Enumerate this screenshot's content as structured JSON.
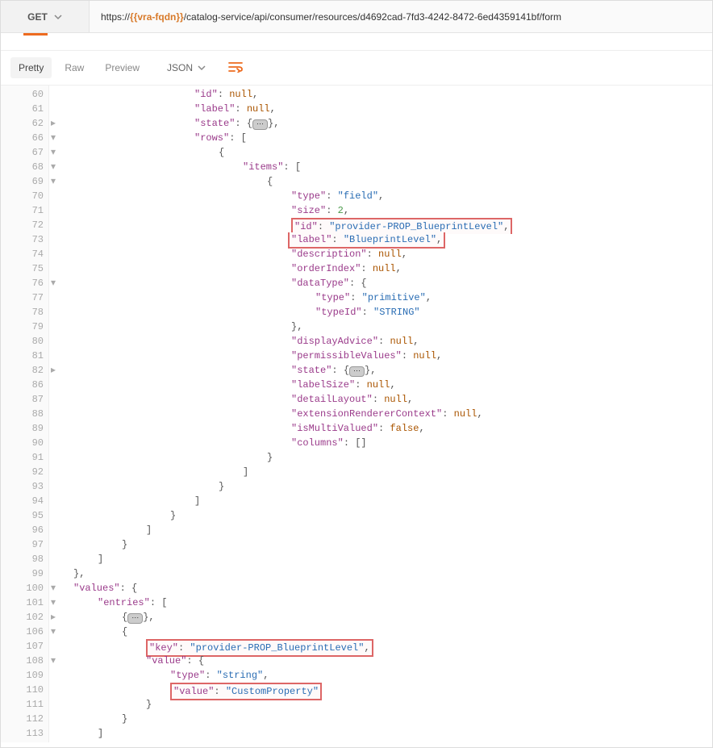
{
  "request": {
    "method": "GET",
    "url_prefix": "https://",
    "url_var": "{{vra-fqdn}}",
    "url_suffix": "/catalog-service/api/consumer/resources/d4692cad-7fd3-4242-8472-6ed4359141bf/form"
  },
  "tabs": {
    "pretty": "Pretty",
    "raw": "Raw",
    "preview": "Preview",
    "format": "JSON"
  },
  "lines": [
    {
      "no": "60",
      "m": "",
      "ind": 240,
      "t": [
        [
          "k",
          "\"id\""
        ],
        [
          "p",
          ": "
        ],
        [
          "kw",
          "null"
        ],
        [
          "p",
          ","
        ]
      ]
    },
    {
      "no": "61",
      "m": "",
      "ind": 240,
      "t": [
        [
          "k",
          "\"label\""
        ],
        [
          "p",
          ": "
        ],
        [
          "kw",
          "null"
        ],
        [
          "p",
          ","
        ]
      ]
    },
    {
      "no": "62",
      "m": "▸",
      "ind": 240,
      "t": [
        [
          "k",
          "\"state\""
        ],
        [
          "p",
          ": {"
        ],
        [
          "collap",
          "⋯"
        ],
        [
          "p",
          "},"
        ]
      ]
    },
    {
      "no": "66",
      "m": "▾",
      "ind": 240,
      "t": [
        [
          "k",
          "\"rows\""
        ],
        [
          "p",
          ": ["
        ]
      ]
    },
    {
      "no": "67",
      "m": "▾",
      "ind": 270,
      "t": [
        [
          "p",
          "{"
        ]
      ]
    },
    {
      "no": "68",
      "m": "▾",
      "ind": 300,
      "t": [
        [
          "k",
          "\"items\""
        ],
        [
          "p",
          ": ["
        ]
      ]
    },
    {
      "no": "69",
      "m": "▾",
      "ind": 330,
      "t": [
        [
          "p",
          "{"
        ]
      ]
    },
    {
      "no": "70",
      "m": "",
      "ind": 360,
      "t": [
        [
          "k",
          "\"type\""
        ],
        [
          "p",
          ": "
        ],
        [
          "s",
          "\"field\""
        ],
        [
          "p",
          ","
        ]
      ]
    },
    {
      "no": "71",
      "m": "",
      "ind": 360,
      "t": [
        [
          "k",
          "\"size\""
        ],
        [
          "p",
          ": "
        ],
        [
          "n",
          "2"
        ],
        [
          "p",
          ","
        ]
      ]
    },
    {
      "no": "72",
      "m": "",
      "ind": 360,
      "hl": true,
      "t": [
        [
          "k",
          "\"id\""
        ],
        [
          "p",
          ": "
        ],
        [
          "s",
          "\"provider-PROP_BlueprintLevel\""
        ],
        [
          "p",
          ","
        ]
      ]
    },
    {
      "no": "73",
      "m": "",
      "ind": 360,
      "hl": true,
      "samebox": true,
      "t": [
        [
          "k",
          "\"label\""
        ],
        [
          "p",
          ": "
        ],
        [
          "s",
          "\"BlueprintLevel\""
        ],
        [
          "p",
          ","
        ]
      ]
    },
    {
      "no": "74",
      "m": "",
      "ind": 360,
      "t": [
        [
          "k",
          "\"description\""
        ],
        [
          "p",
          ": "
        ],
        [
          "kw",
          "null"
        ],
        [
          "p",
          ","
        ]
      ]
    },
    {
      "no": "75",
      "m": "",
      "ind": 360,
      "t": [
        [
          "k",
          "\"orderIndex\""
        ],
        [
          "p",
          ": "
        ],
        [
          "kw",
          "null"
        ],
        [
          "p",
          ","
        ]
      ]
    },
    {
      "no": "76",
      "m": "▾",
      "ind": 360,
      "t": [
        [
          "k",
          "\"dataType\""
        ],
        [
          "p",
          ": {"
        ]
      ]
    },
    {
      "no": "77",
      "m": "",
      "ind": 390,
      "t": [
        [
          "k",
          "\"type\""
        ],
        [
          "p",
          ": "
        ],
        [
          "s",
          "\"primitive\""
        ],
        [
          "p",
          ","
        ]
      ]
    },
    {
      "no": "78",
      "m": "",
      "ind": 390,
      "t": [
        [
          "k",
          "\"typeId\""
        ],
        [
          "p",
          ": "
        ],
        [
          "s",
          "\"STRING\""
        ]
      ]
    },
    {
      "no": "79",
      "m": "",
      "ind": 360,
      "t": [
        [
          "p",
          "},"
        ]
      ]
    },
    {
      "no": "80",
      "m": "",
      "ind": 360,
      "t": [
        [
          "k",
          "\"displayAdvice\""
        ],
        [
          "p",
          ": "
        ],
        [
          "kw",
          "null"
        ],
        [
          "p",
          ","
        ]
      ]
    },
    {
      "no": "81",
      "m": "",
      "ind": 360,
      "t": [
        [
          "k",
          "\"permissibleValues\""
        ],
        [
          "p",
          ": "
        ],
        [
          "kw",
          "null"
        ],
        [
          "p",
          ","
        ]
      ]
    },
    {
      "no": "82",
      "m": "▸",
      "ind": 360,
      "t": [
        [
          "k",
          "\"state\""
        ],
        [
          "p",
          ": {"
        ],
        [
          "collap",
          "⋯"
        ],
        [
          "p",
          "},"
        ]
      ]
    },
    {
      "no": "86",
      "m": "",
      "ind": 360,
      "t": [
        [
          "k",
          "\"labelSize\""
        ],
        [
          "p",
          ": "
        ],
        [
          "kw",
          "null"
        ],
        [
          "p",
          ","
        ]
      ]
    },
    {
      "no": "87",
      "m": "",
      "ind": 360,
      "t": [
        [
          "k",
          "\"detailLayout\""
        ],
        [
          "p",
          ": "
        ],
        [
          "kw",
          "null"
        ],
        [
          "p",
          ","
        ]
      ]
    },
    {
      "no": "88",
      "m": "",
      "ind": 360,
      "t": [
        [
          "k",
          "\"extensionRendererContext\""
        ],
        [
          "p",
          ": "
        ],
        [
          "kw",
          "null"
        ],
        [
          "p",
          ","
        ]
      ]
    },
    {
      "no": "89",
      "m": "",
      "ind": 360,
      "t": [
        [
          "k",
          "\"isMultiValued\""
        ],
        [
          "p",
          ": "
        ],
        [
          "kw",
          "false"
        ],
        [
          "p",
          ","
        ]
      ]
    },
    {
      "no": "90",
      "m": "",
      "ind": 360,
      "t": [
        [
          "k",
          "\"columns\""
        ],
        [
          "p",
          ": []"
        ]
      ]
    },
    {
      "no": "91",
      "m": "",
      "ind": 330,
      "t": [
        [
          "p",
          "}"
        ]
      ]
    },
    {
      "no": "92",
      "m": "",
      "ind": 300,
      "t": [
        [
          "p",
          "]"
        ]
      ]
    },
    {
      "no": "93",
      "m": "",
      "ind": 270,
      "t": [
        [
          "p",
          "}"
        ]
      ]
    },
    {
      "no": "94",
      "m": "",
      "ind": 240,
      "t": [
        [
          "p",
          "]"
        ]
      ]
    },
    {
      "no": "95",
      "m": "",
      "ind": 210,
      "t": [
        [
          "p",
          "}"
        ]
      ]
    },
    {
      "no": "96",
      "m": "",
      "ind": 180,
      "t": [
        [
          "p",
          "]"
        ]
      ]
    },
    {
      "no": "97",
      "m": "",
      "ind": 150,
      "t": [
        [
          "p",
          "}"
        ]
      ]
    },
    {
      "no": "98",
      "m": "",
      "ind": 120,
      "t": [
        [
          "p",
          "]"
        ]
      ]
    },
    {
      "no": "99",
      "m": "",
      "ind": 90,
      "t": [
        [
          "p",
          "},"
        ]
      ]
    },
    {
      "no": "100",
      "m": "▾",
      "ind": 90,
      "t": [
        [
          "k",
          "\"values\""
        ],
        [
          "p",
          ": {"
        ]
      ]
    },
    {
      "no": "101",
      "m": "▾",
      "ind": 120,
      "t": [
        [
          "k",
          "\"entries\""
        ],
        [
          "p",
          ": ["
        ]
      ]
    },
    {
      "no": "102",
      "m": "▸",
      "ind": 150,
      "t": [
        [
          "p",
          "{"
        ],
        [
          "collap",
          "⋯"
        ],
        [
          "p",
          "},"
        ]
      ]
    },
    {
      "no": "106",
      "m": "▾",
      "ind": 150,
      "t": [
        [
          "p",
          "{"
        ]
      ]
    },
    {
      "no": "107",
      "m": "",
      "ind": 180,
      "hl": true,
      "t": [
        [
          "k",
          "\"key\""
        ],
        [
          "p",
          ": "
        ],
        [
          "s",
          "\"provider-PROP_BlueprintLevel\""
        ],
        [
          "p",
          ","
        ]
      ]
    },
    {
      "no": "108",
      "m": "▾",
      "ind": 180,
      "t": [
        [
          "k",
          "\"value\""
        ],
        [
          "p",
          ": {"
        ]
      ]
    },
    {
      "no": "109",
      "m": "",
      "ind": 210,
      "t": [
        [
          "k",
          "\"type\""
        ],
        [
          "p",
          ": "
        ],
        [
          "s",
          "\"string\""
        ],
        [
          "p",
          ","
        ]
      ]
    },
    {
      "no": "110",
      "m": "",
      "ind": 210,
      "hl": true,
      "t": [
        [
          "k",
          "\"value\""
        ],
        [
          "p",
          ": "
        ],
        [
          "s",
          "\"CustomProperty\""
        ]
      ]
    },
    {
      "no": "111",
      "m": "",
      "ind": 180,
      "t": [
        [
          "p",
          "}"
        ]
      ]
    },
    {
      "no": "112",
      "m": "",
      "ind": 150,
      "t": [
        [
          "p",
          "}"
        ]
      ]
    },
    {
      "no": "113",
      "m": "",
      "ind": 120,
      "t": [
        [
          "p",
          "]"
        ]
      ]
    }
  ]
}
